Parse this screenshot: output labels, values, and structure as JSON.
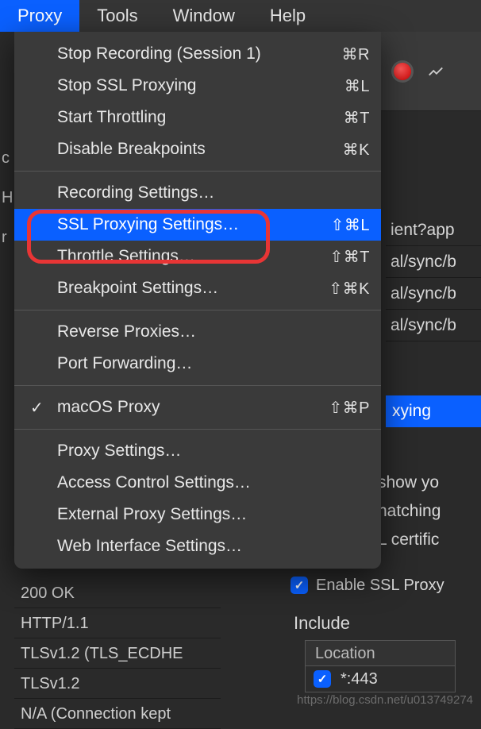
{
  "menubar": {
    "proxy": "Proxy",
    "tools": "Tools",
    "window": "Window",
    "help": "Help"
  },
  "menu": {
    "stop_recording": {
      "label": "Stop Recording (Session 1)",
      "shortcut": "⌘R"
    },
    "stop_ssl": {
      "label": "Stop SSL Proxying",
      "shortcut": "⌘L"
    },
    "start_throttling": {
      "label": "Start Throttling",
      "shortcut": "⌘T"
    },
    "disable_breakpoints": {
      "label": "Disable Breakpoints",
      "shortcut": "⌘K"
    },
    "recording_settings": {
      "label": "Recording Settings…",
      "shortcut": ""
    },
    "ssl_proxying_settings": {
      "label": "SSL Proxying Settings…",
      "shortcut": "⇧⌘L"
    },
    "throttle_settings": {
      "label": "Throttle Settings…",
      "shortcut": "⇧⌘T"
    },
    "breakpoint_settings": {
      "label": "Breakpoint Settings…",
      "shortcut": "⇧⌘K"
    },
    "reverse_proxies": {
      "label": "Reverse Proxies…",
      "shortcut": ""
    },
    "port_forwarding": {
      "label": "Port Forwarding…",
      "shortcut": ""
    },
    "macos_proxy": {
      "label": "macOS Proxy",
      "shortcut": "⇧⌘P",
      "check": "✓"
    },
    "proxy_settings": {
      "label": "Proxy Settings…",
      "shortcut": ""
    },
    "access_control": {
      "label": "Access Control Settings…",
      "shortcut": ""
    },
    "external_proxy": {
      "label": "External Proxy Settings…",
      "shortcut": ""
    },
    "web_interface": {
      "label": "Web Interface Settings…",
      "shortcut": ""
    }
  },
  "side": {
    "r1": "ient?app",
    "r2": "al/sync/b",
    "r3": "al/sync/b",
    "r4": "al/sync/b",
    "badge": "xying"
  },
  "right_text": {
    "l1": " show yo",
    "l2": "natching",
    "l3": "L certific"
  },
  "bottom": {
    "r1": "200 OK",
    "r2": "HTTP/1.1",
    "r3": "TLSv1.2 (TLS_ECDHE",
    "r4": "TLSv1.2",
    "r5": "N/A (Connection kept"
  },
  "panel": {
    "enable": "Enable SSL Proxy",
    "include": "Include",
    "location_header": "Location",
    "location_value": "*:443",
    "check": "✓"
  },
  "left_strip": {
    "c": "c",
    "h": "H",
    "r": "r"
  },
  "watermark": "https://blog.csdn.net/u013749274"
}
